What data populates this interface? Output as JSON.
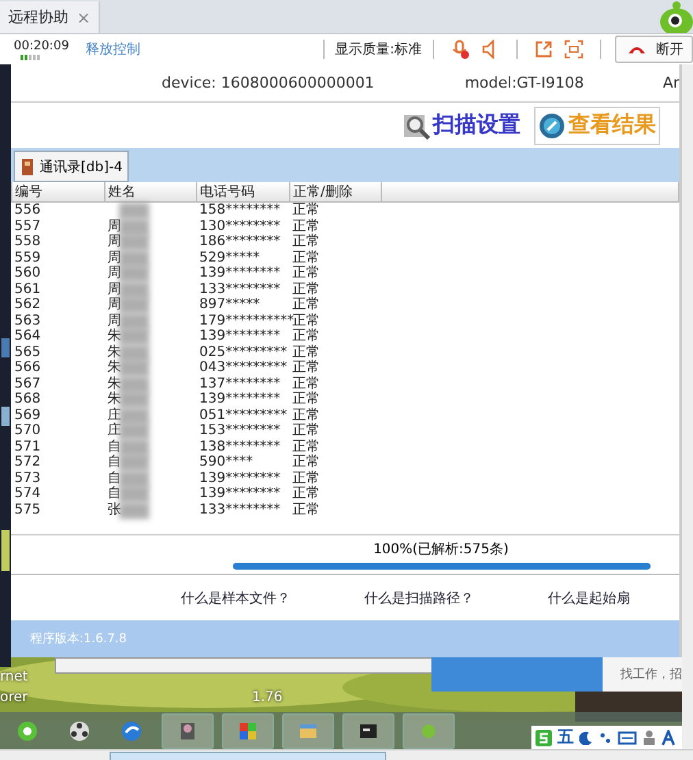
{
  "remote_tab": {
    "title": "远程协助",
    "close": "×",
    "selected": true
  },
  "toolbar": {
    "timer": "00:20:09",
    "release_link": "释放控制",
    "quality": "显示质量:标准",
    "disconnect": "断开"
  },
  "device_info": {
    "device": "device: 1608000600000001",
    "model": "model:GT-I9108",
    "extra": "Ar"
  },
  "actions": [
    {
      "kind": "settings",
      "label": "扫描设置"
    },
    {
      "kind": "results",
      "label": "查看结果"
    }
  ],
  "tabs": [
    {
      "label": "通讯录[db]-4",
      "selected": true
    }
  ],
  "table": {
    "columns": [
      "编号",
      "姓名",
      "电话号码",
      "正常/删除"
    ],
    "rows": [
      {
        "id": "556",
        "phone": "158********",
        "status": "正常"
      },
      {
        "id": "557",
        "name": "周",
        "phone": "130********",
        "status": "正常"
      },
      {
        "id": "558",
        "name": "周",
        "phone": "186********",
        "status": "正常"
      },
      {
        "id": "559",
        "name": "周",
        "phone": "529*****",
        "status": "正常"
      },
      {
        "id": "560",
        "name": "周",
        "phone": "139********",
        "status": "正常"
      },
      {
        "id": "561",
        "name": "周",
        "phone": "133********",
        "status": "正常"
      },
      {
        "id": "562",
        "name": "周",
        "phone": "897*****",
        "status": "正常"
      },
      {
        "id": "563",
        "name": "周",
        "phone": "179**********",
        "status": "正常"
      },
      {
        "id": "564",
        "name": "朱",
        "phone": "139********",
        "status": "正常"
      },
      {
        "id": "565",
        "name": "朱",
        "phone": "025*********",
        "status": "正常"
      },
      {
        "id": "566",
        "name": "朱",
        "phone": "043*********",
        "status": "正常"
      },
      {
        "id": "567",
        "name": "朱",
        "phone": "137********",
        "status": "正常"
      },
      {
        "id": "568",
        "name": "朱",
        "phone": "139********",
        "status": "正常"
      },
      {
        "id": "569",
        "name": "庄",
        "phone": "051*********",
        "status": "正常"
      },
      {
        "id": "570",
        "name": "庄",
        "phone": "153********",
        "status": "正常"
      },
      {
        "id": "571",
        "name": "自",
        "phone": "138********",
        "status": "正常"
      },
      {
        "id": "572",
        "name": "自",
        "phone": "590****",
        "status": "正常"
      },
      {
        "id": "573",
        "name": "自",
        "phone": "139********",
        "status": "正常"
      },
      {
        "id": "574",
        "name": "自",
        "phone": "139********",
        "status": "正常"
      },
      {
        "id": "575",
        "name": "张",
        "phone": "133********",
        "status": "正常"
      }
    ]
  },
  "progress": {
    "text": "100%(已解析:575条)",
    "level": 1
  },
  "help_links": [
    "什么是样本文件？",
    "什么是扫描路径？",
    "什么是起始扇"
  ],
  "version": "程序版本:1.6.7.8",
  "desktop": {
    "labels": [
      "rnet",
      "orer",
      "1.76"
    ],
    "notice": "找工作，招"
  },
  "tray": {
    "ime": "五"
  }
}
